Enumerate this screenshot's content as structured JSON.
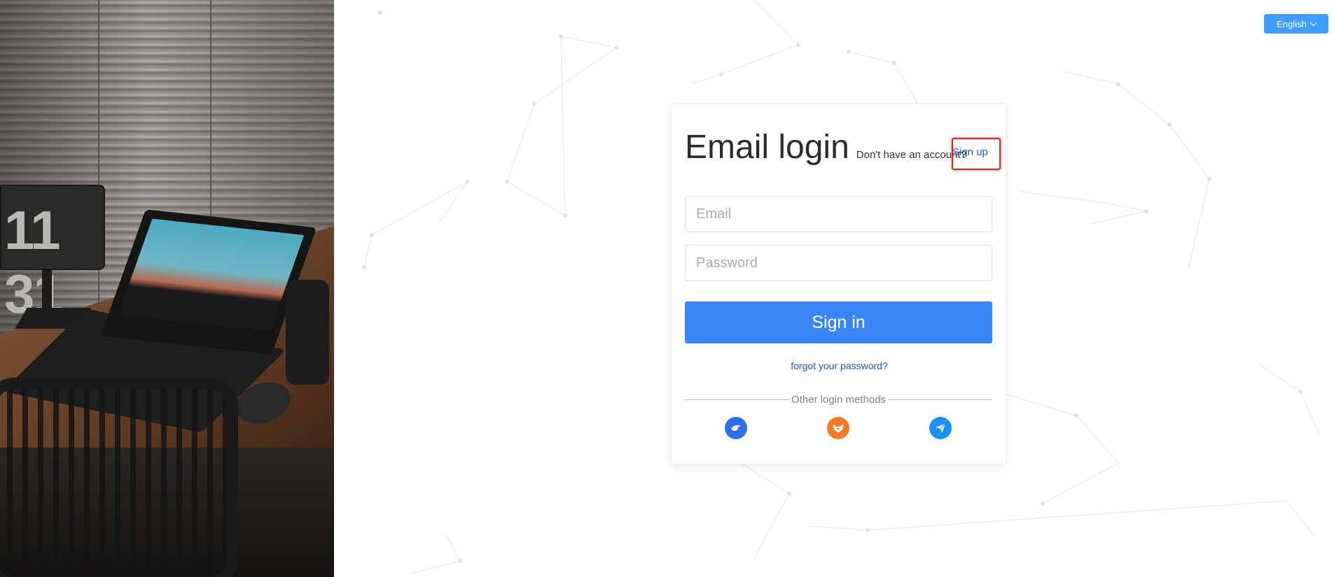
{
  "header": {
    "language_label": "English"
  },
  "login": {
    "title": "Email login",
    "no_account_text": "Don't have an account?",
    "signup_label": "Sign up",
    "email_placeholder": "Email",
    "password_placeholder": "Password",
    "signin_label": "Sign in",
    "forgot_label": "forgot your password?",
    "other_methods_label": "Other login methods"
  },
  "social_logins": [
    {
      "icon": "blue-bird-icon",
      "color": "#2f6fe4"
    },
    {
      "icon": "fox-icon",
      "color": "#f07a27"
    },
    {
      "icon": "paper-plane-icon",
      "color": "#1d8ff0"
    }
  ],
  "photo": {
    "clock_text": "11 31"
  },
  "colors": {
    "primary": "#3a86f7",
    "link": "#1f5aa8",
    "highlight": "#e02020"
  }
}
